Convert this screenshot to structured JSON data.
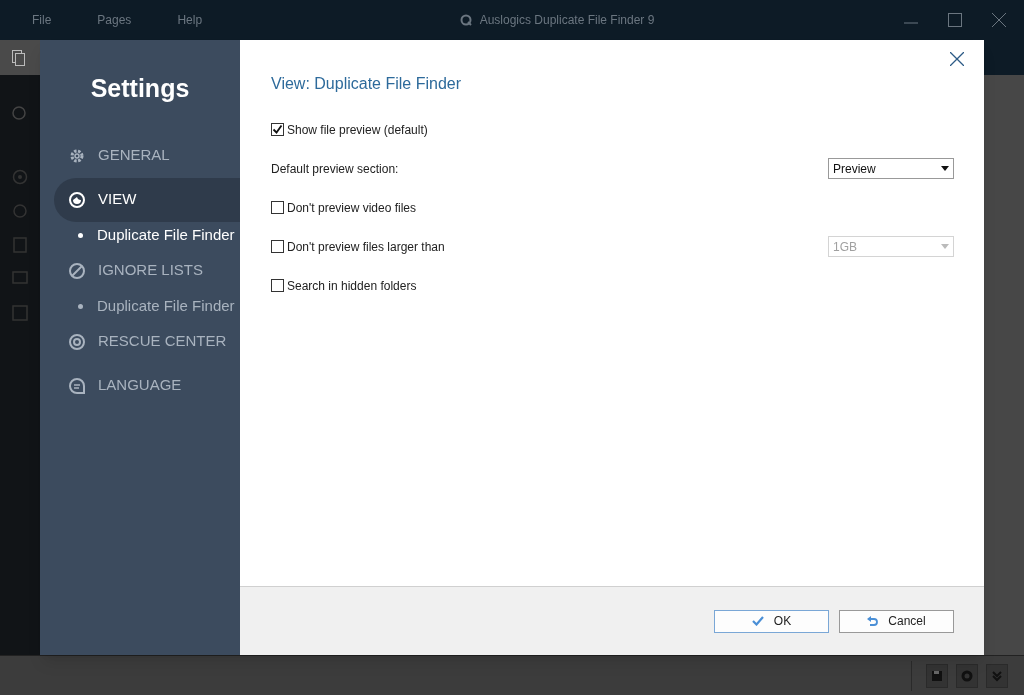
{
  "window": {
    "menu": [
      "File",
      "Pages",
      "Help"
    ],
    "title": "Auslogics Duplicate File Finder 9"
  },
  "settings": {
    "title": "Settings",
    "nav": [
      {
        "kind": "section",
        "label": "GENERAL",
        "selected": false
      },
      {
        "kind": "section",
        "label": "VIEW",
        "selected": true
      },
      {
        "kind": "sub",
        "label": "Duplicate File Finder",
        "selected": true
      },
      {
        "kind": "section",
        "label": "IGNORE LISTS",
        "selected": false
      },
      {
        "kind": "sub",
        "label": "Duplicate File Finder",
        "selected": false
      },
      {
        "kind": "section",
        "label": "RESCUE CENTER",
        "selected": false
      },
      {
        "kind": "section",
        "label": "LANGUAGE",
        "selected": false
      }
    ],
    "heading": "View: Duplicate File Finder",
    "options": [
      {
        "kind": "checkbox",
        "label": "Show file preview (default)",
        "checked": true
      },
      {
        "kind": "dropdown",
        "label": "Default preview section:",
        "value": "Preview",
        "disabled": false
      },
      {
        "kind": "checkbox",
        "label": "Don't preview video files",
        "checked": false
      },
      {
        "kind": "checkbox_dropdown",
        "label": "Don't preview files larger than",
        "checked": false,
        "value": "1GB",
        "disabled": true
      },
      {
        "kind": "checkbox",
        "label": "Search in hidden folders",
        "checked": false
      }
    ],
    "buttons": [
      {
        "kind": "ok",
        "label": "OK"
      },
      {
        "kind": "cancel",
        "label": "Cancel"
      }
    ]
  }
}
